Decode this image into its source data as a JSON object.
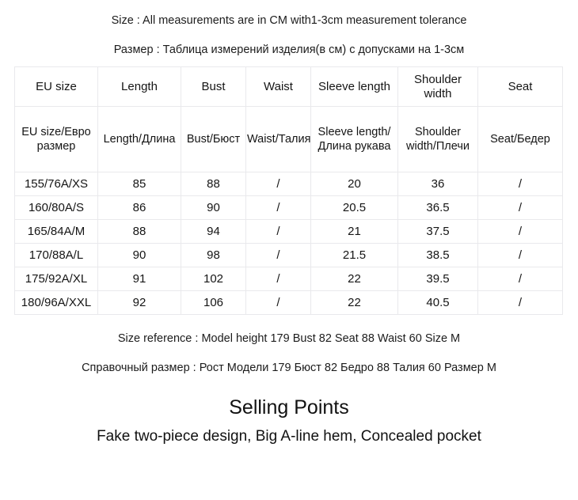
{
  "intro": {
    "line_en": "Size : All measurements are in CM with1-3cm measurement tolerance",
    "line_ru": "Размер : Таблица измерений изделия(в см) с допусками на 1-3см"
  },
  "table": {
    "headers_en": [
      "EU size",
      "Length",
      "Bust",
      "Waist",
      "Sleeve length",
      "Shoulder width",
      "Seat"
    ],
    "headers_ru": [
      "EU size/Евро размер",
      "Length/Длина",
      "Bust/Бюст",
      "Waist/Талия",
      "Sleeve length/Длина рукава",
      "Shoulder width/Плечи",
      "Seat/Бедер"
    ],
    "rows": [
      [
        "155/76A/XS",
        "85",
        "88",
        "/",
        "20",
        "36",
        "/"
      ],
      [
        "160/80A/S",
        "86",
        "90",
        "/",
        "20.5",
        "36.5",
        "/"
      ],
      [
        "165/84A/M",
        "88",
        "94",
        "/",
        "21",
        "37.5",
        "/"
      ],
      [
        "170/88A/L",
        "90",
        "98",
        "/",
        "21.5",
        "38.5",
        "/"
      ],
      [
        "175/92A/XL",
        "91",
        "102",
        "/",
        "22",
        "39.5",
        "/"
      ],
      [
        "180/96A/XXL",
        "92",
        "106",
        "/",
        "22",
        "40.5",
        "/"
      ]
    ]
  },
  "footer": {
    "line_en": "Size reference : Model  height 179  Bust 82  Seat 88  Waist 60  Size M",
    "line_ru": "Справочный размер : Рост Модели 179 Бюст 82 Бедро 88 Талия 60 Размер M"
  },
  "selling_points": {
    "title": "Selling Points",
    "subtitle": "Fake two-piece design, Big A-line hem, Concealed pocket"
  },
  "colors": {
    "text": "#1a1a1a",
    "border": "#e9e9ec",
    "background": "#ffffff"
  }
}
